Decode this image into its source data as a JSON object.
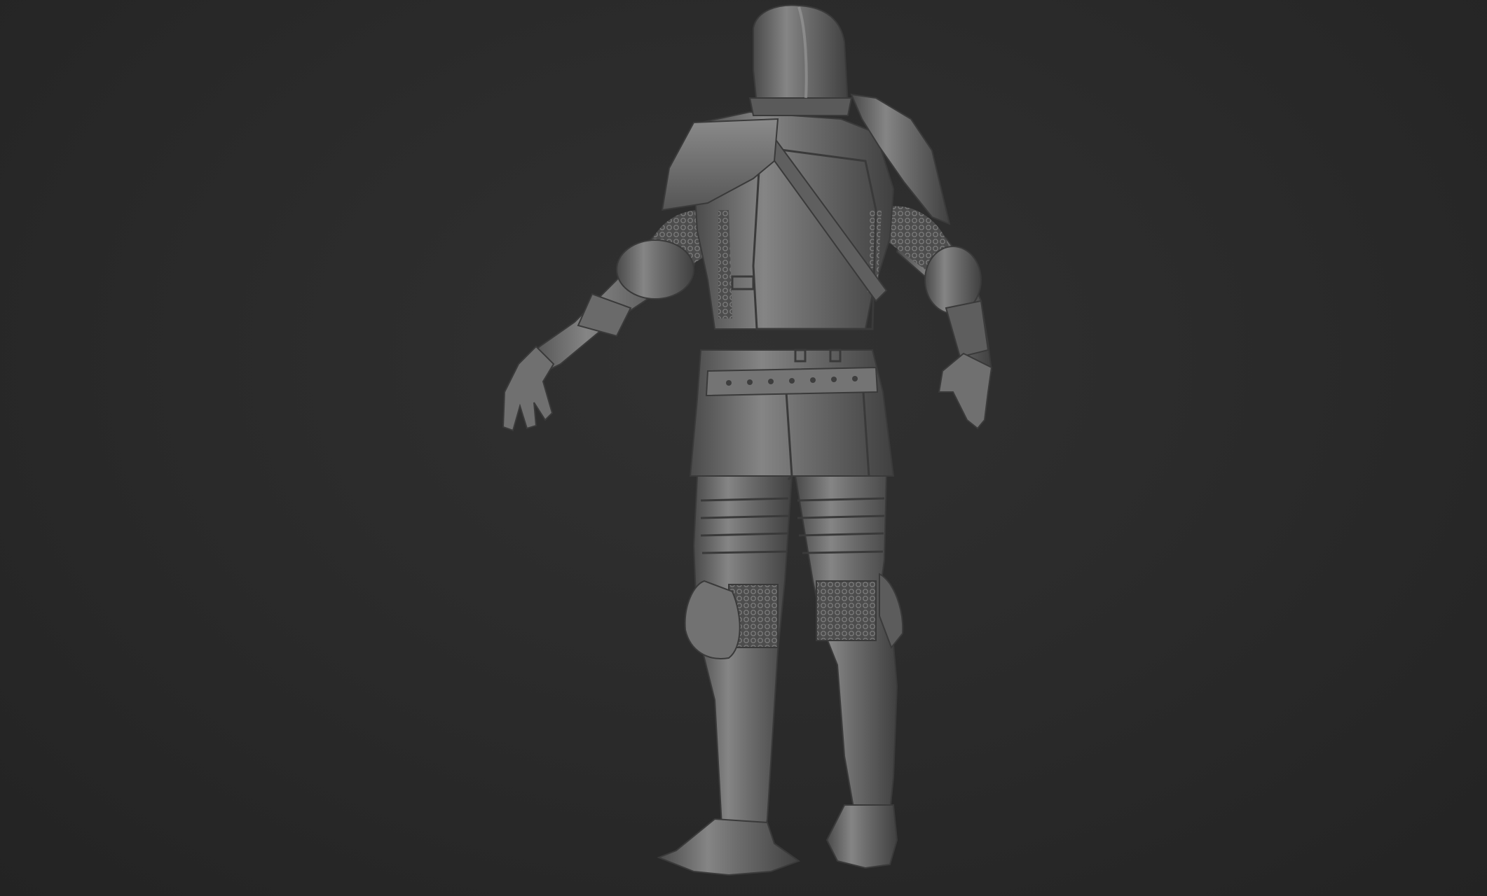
{
  "viewport": {
    "background_color": "#2b2b2b",
    "model_base_color": "#6f6f6f",
    "model_shadow_color": "#3e3e3e",
    "model_highlight_color": "#9a9a9a"
  },
  "model": {
    "subject": "knight-armor",
    "view": "back",
    "pose": "a-pose"
  }
}
